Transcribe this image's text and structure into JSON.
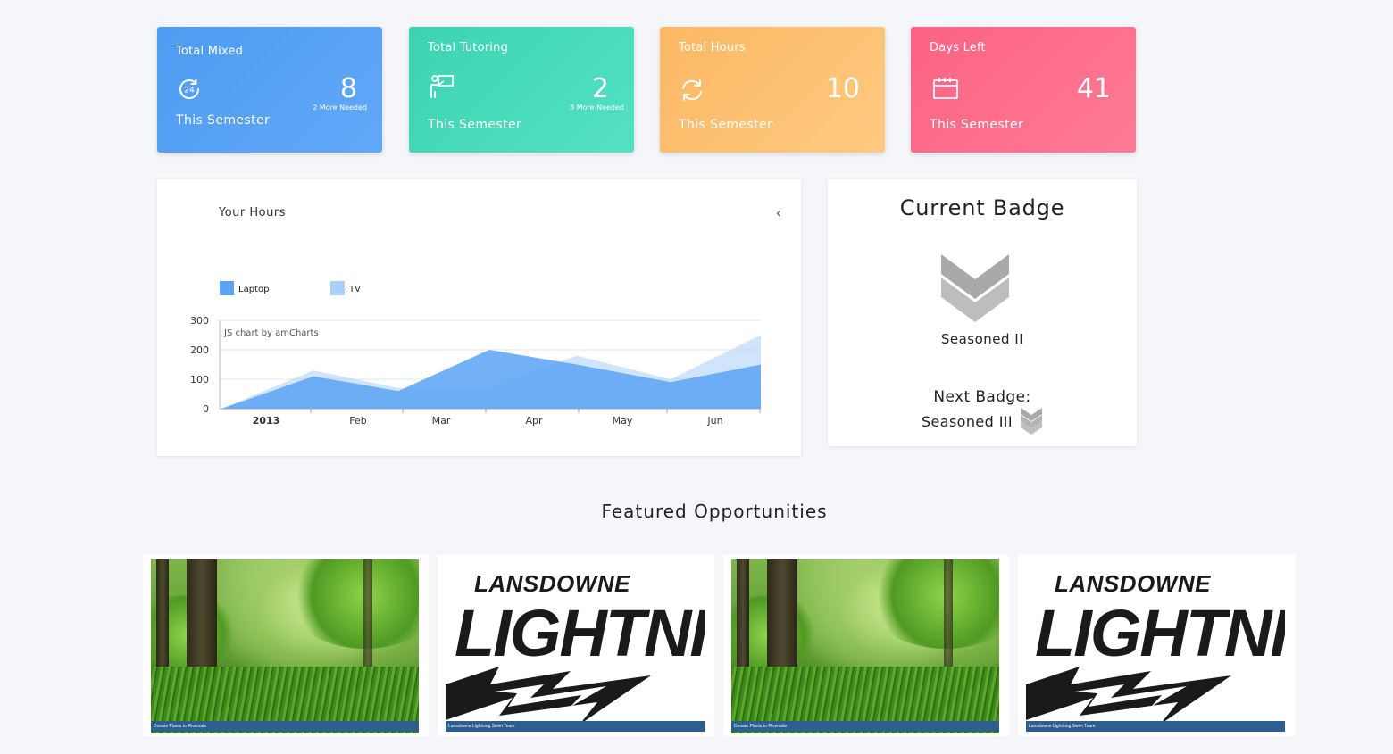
{
  "stats": [
    {
      "title": "Total Mixed",
      "value": "8",
      "needed": "2 More Needed",
      "subtitle": "This Semester",
      "icon": "24-hours-icon",
      "color": "#4e9cf2"
    },
    {
      "title": "Total Tutoring",
      "value": "2",
      "needed": "3 More Needed",
      "subtitle": "This Semester",
      "icon": "teacher-icon",
      "color": "#3bd4b2"
    },
    {
      "title": "Total Hours",
      "value": "10",
      "subtitle": "This Semester",
      "icon": "refresh-icon",
      "color": "#fdb864"
    },
    {
      "title": "Days Left",
      "value": "41",
      "subtitle": "This Semester",
      "icon": "calendar-icon",
      "color": "#fc6284"
    }
  ],
  "hours_panel": {
    "title": "Your Hours",
    "collapse_icon": "chevron-left-icon",
    "credit": "JS chart by amCharts"
  },
  "chart_data": {
    "type": "area",
    "title": "",
    "x": [
      "2013",
      "Feb",
      "Mar",
      "Apr",
      "May",
      "Jun"
    ],
    "x_ticks": [
      "2013",
      "Feb",
      "Mar",
      "Apr",
      "May",
      "Jun"
    ],
    "xlabel": "",
    "ylabel": "",
    "ylim": [
      0,
      300
    ],
    "y_ticks": [
      0,
      100,
      200,
      300
    ],
    "grid": true,
    "legend_position": "top-left",
    "series": [
      {
        "name": "Laptop",
        "color": "#5aa3f5",
        "values": [
          0,
          110,
          60,
          200,
          150,
          90,
          150
        ]
      },
      {
        "name": "TV",
        "color": "#a9cffa",
        "values": [
          0,
          130,
          70,
          70,
          180,
          100,
          250
        ]
      }
    ],
    "x_points": [
      "2013",
      "Feb",
      "Mar",
      "Mar-mid",
      "Apr-mid",
      "May-mid",
      "Jun-end"
    ]
  },
  "badge": {
    "heading": "Current Badge",
    "current": "Seasoned II",
    "next_label": "Next Badge:",
    "next": "Seasoned III",
    "icon": "chevron-badge-icon"
  },
  "featured": {
    "heading": "Featured Opportunities",
    "items": [
      {
        "caption": "Donate Plants to Riverside",
        "image": "forest"
      },
      {
        "caption": "Lansdowne Lightning Swim Team",
        "image": "logo",
        "logo_top": "LANSDOWNE",
        "logo_main": "LIGHTNING"
      },
      {
        "caption": "Donate Plants to Riverside",
        "image": "forest"
      },
      {
        "caption": "Lansdowne Lightning Swim Team",
        "image": "logo",
        "logo_top": "LANSDOWNE",
        "logo_main": "LIGHTNING"
      }
    ]
  }
}
